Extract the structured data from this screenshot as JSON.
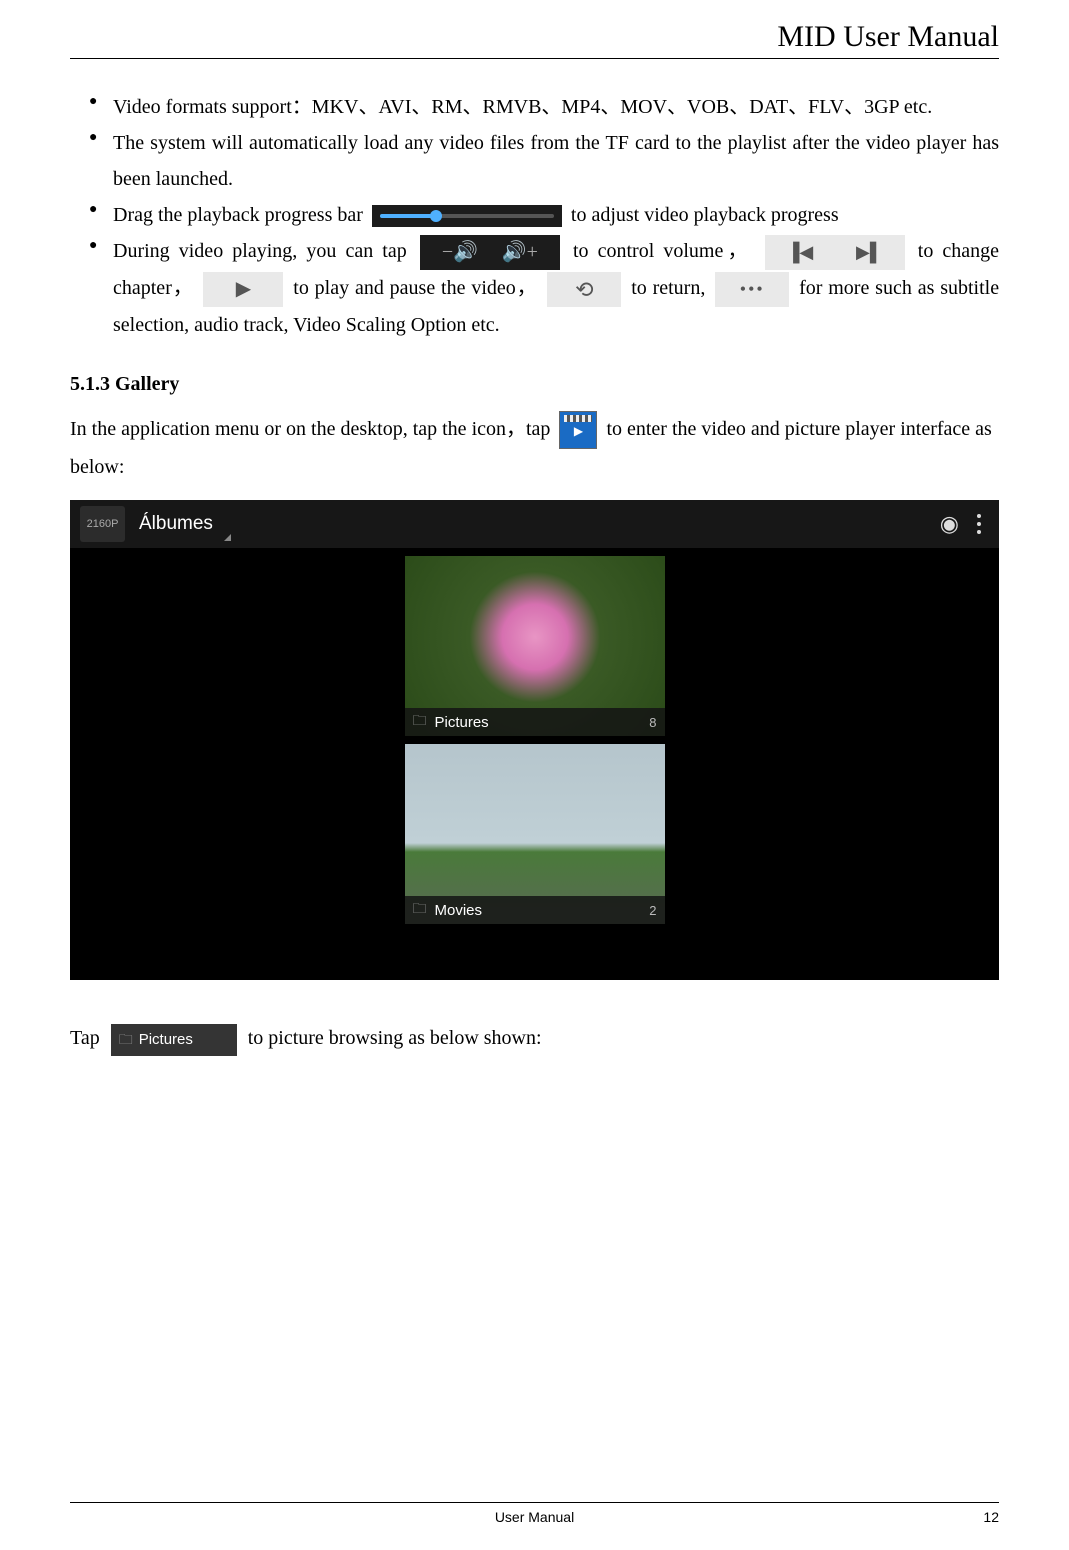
{
  "header": {
    "title": "MID User Manual"
  },
  "bullets": {
    "b1": "Video formats support：MKV、AVI、RM、RMVB、MP4、MOV、VOB、DAT、FLV、3GP etc.",
    "b2": "The system will automatically load any video files from the TF card to the playlist after the video player has been launched.",
    "b3_pre": "Drag the playback progress bar ",
    "b3_post": " to adjust video playback progress",
    "b4_a": "During video playing, you can tap",
    "b4_b": " to control volume，",
    "b4_c": "to change chapter，",
    "b4_d": " to play and pause the video，",
    "b4_e": "to return,",
    "b4_f": " for more such as subtitle selection, audio track, Video Scaling Option etc."
  },
  "section": {
    "heading": "5.1.3 Gallery",
    "intro_a": "In the application menu or on the desktop, tap the icon，tap ",
    "intro_b": " to enter the video and picture player interface as below:"
  },
  "screenshot": {
    "dropdown": "Álbumes",
    "logo_hint": "2160P",
    "folders": {
      "pictures": {
        "label": "Pictures",
        "count": "8"
      },
      "movies": {
        "label": "Movies",
        "count": "2"
      }
    }
  },
  "after_screenshot": {
    "tap_a": "Tap ",
    "folder_label": "Pictures",
    "tap_b": " to picture browsing as below shown:"
  },
  "footer": {
    "center": "User Manual",
    "page": "12"
  }
}
